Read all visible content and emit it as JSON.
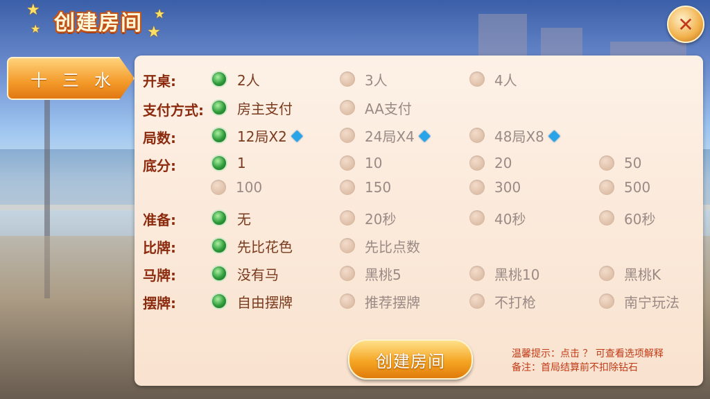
{
  "header": {
    "title": "创建房间",
    "close_label": "✕"
  },
  "side_tab": {
    "label": "十三水"
  },
  "rows": [
    {
      "label": "开桌:",
      "options": [
        "2人",
        "3人",
        "4人"
      ],
      "selected": 0
    },
    {
      "label": "支付方式:",
      "options": [
        "房主支付",
        "AA支付"
      ],
      "selected": 0
    },
    {
      "label": "局数:",
      "options": [
        "12局X2",
        "24局X4",
        "48局X8"
      ],
      "selected": 0
    },
    {
      "label": "底分:",
      "options": [
        "1",
        "10",
        "20",
        "50",
        "100",
        "150",
        "300",
        "500"
      ],
      "selected": 0
    },
    {
      "label": "准备:",
      "options": [
        "无",
        "20秒",
        "40秒",
        "60秒"
      ],
      "selected": 0
    },
    {
      "label": "比牌:",
      "options": [
        "先比花色",
        "先比点数"
      ],
      "selected": 0
    },
    {
      "label": "马牌:",
      "options": [
        "没有马",
        "黑桃5",
        "黑桃10",
        "黑桃K"
      ],
      "selected": 0
    },
    {
      "label": "摆牌:",
      "options": [
        "自由摆牌",
        "推荐摆牌",
        "不打枪",
        "南宁玩法"
      ],
      "selected": 0
    }
  ],
  "create_button": {
    "label": "创建房间"
  },
  "tips": {
    "line1": "温馨提示：点击 ？ 可查看选项解释",
    "line2": "备注：首局结算前不扣除钻石"
  },
  "icons": {
    "diamond": "diamond-icon",
    "close": "close-icon"
  },
  "colors": {
    "label": "#8c2a0e",
    "selected_radio": "#2e9a3a",
    "tip": "#c03a16",
    "button": "#f5a623"
  }
}
